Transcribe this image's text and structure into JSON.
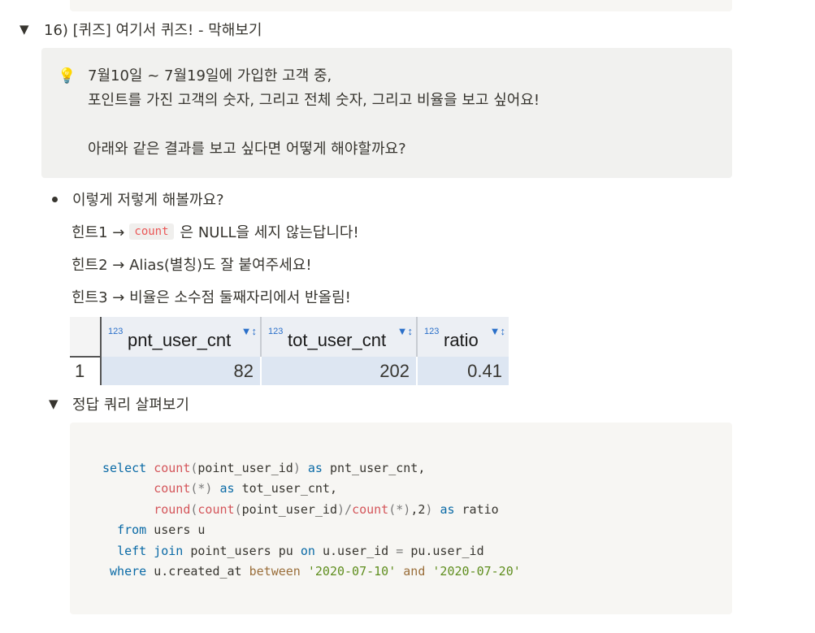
{
  "section": {
    "title": "16) [퀴즈] 여기서 퀴즈! - 막해보기"
  },
  "callout": {
    "icon": "lightbulb-icon",
    "line1": "7월10일 ~ 7월19일에 가입한 고객 중,",
    "line2": "포인트를 가진 고객의 숫자, 그리고 전체 숫자, 그리고 비율을 보고 싶어요!",
    "line3": "아래와 같은 결과를 보고 싶다면 어떻게 해야할까요?"
  },
  "bullet": "이렇게 저렇게 해볼까요?",
  "hints": {
    "hint1_prefix": "힌트1 →",
    "hint1_code": "count",
    "hint1_suffix": "은 NULL을 세지 않는답니다!",
    "hint2": "힌트2 → Alias(별칭)도 잘 붙여주세요!",
    "hint3": "힌트3 → 비율은 소수점 둘째자리에서 반올림!"
  },
  "result_table": {
    "type_badge": "123",
    "columns": [
      "pnt_user_cnt",
      "tot_user_cnt",
      "ratio"
    ],
    "row_number": "1",
    "row": [
      "82",
      "202",
      "0.41"
    ]
  },
  "answer_toggle": {
    "title": "정답 쿼리 살펴보기"
  },
  "code": {
    "t_select": "select",
    "t_count": "count",
    "t_open": "(",
    "t_point_user_id": "point_user_id",
    "t_close": ")",
    "t_as": "as",
    "t_pnt_alias": "pnt_user_cnt,",
    "t_star": "(*)",
    "t_tot_alias": "tot_user_cnt,",
    "t_round": "round",
    "t_div": "/",
    "t_comma2": ",2",
    "t_ratio": "ratio",
    "t_from": "from",
    "t_users": "users u",
    "t_left": "left",
    "t_join": "join",
    "t_pu_table": "point_users pu",
    "t_on": "on",
    "t_u_user_id": "u.user_id",
    "t_eq": "=",
    "t_pu_user_id": "pu.user_id",
    "t_where": "where",
    "t_created": "u.created_at",
    "t_between": "between",
    "t_date1": "'2020-07-10'",
    "t_and": "and",
    "t_date2": "'2020-07-20'"
  }
}
